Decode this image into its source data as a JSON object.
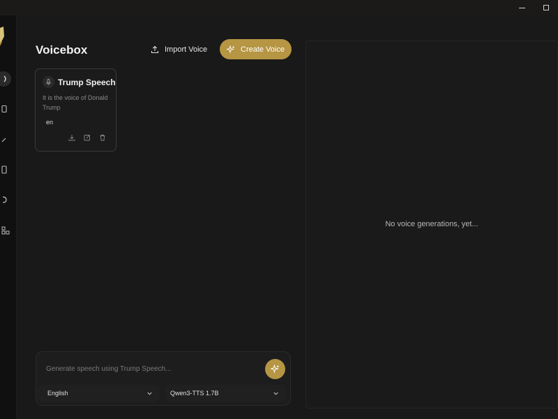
{
  "window": {
    "minimize_icon": "minimize-icon",
    "maximize_icon": "maximize-icon"
  },
  "sidebar": {
    "logo_icon": "voicebox-logo-icon",
    "items": [
      {
        "icon": "speaker-icon",
        "active": true
      },
      {
        "icon": "book-icon",
        "active": false
      },
      {
        "icon": "wand-icon",
        "active": false
      },
      {
        "icon": "document-icon",
        "active": false
      },
      {
        "icon": "server-icon",
        "active": false
      },
      {
        "icon": "grid-icon",
        "active": false
      }
    ]
  },
  "header": {
    "title": "Voicebox",
    "import_label": "Import Voice",
    "create_label": "Create Voice"
  },
  "colors": {
    "accent": "#b69543",
    "background": "#191919",
    "card_border": "#3a3a3a"
  },
  "voices": [
    {
      "name": "Trump Speech",
      "description": "It is the voice of Donald Trump",
      "language": "en",
      "actions": [
        "download-icon",
        "edit-icon",
        "trash-icon"
      ]
    }
  ],
  "generator": {
    "placeholder": "Generate speech using Trump Speech...",
    "language": "English",
    "model": "Qwen3-TTS 1.7B"
  },
  "history": {
    "empty_message": "No voice generations, yet..."
  }
}
